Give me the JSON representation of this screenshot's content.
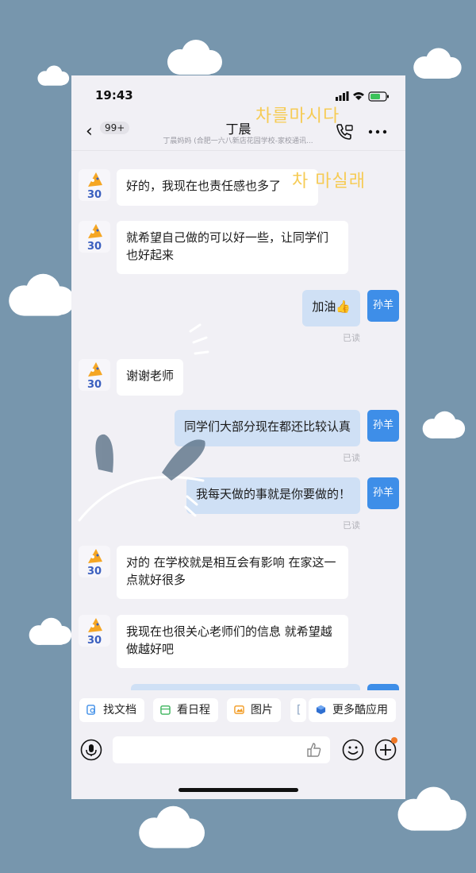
{
  "status_bar": {
    "time": "19:43"
  },
  "header": {
    "back_badge": "99+",
    "title": "丁晨",
    "subtitle": "丁晨妈妈 (合肥一六八新店花园学校-家校通讯..."
  },
  "messages": [
    {
      "side": "left",
      "text": "好的，我现在也责任感也多了"
    },
    {
      "side": "left",
      "text": "就希望自己做的可以好一些，让同学们也好起来"
    },
    {
      "side": "right",
      "text": "加油👍",
      "avatar": "孙羊",
      "status": "已读"
    },
    {
      "side": "left",
      "text": "谢谢老师"
    },
    {
      "side": "right",
      "text": "同学们大部分现在都还比较认真",
      "avatar": "孙羊",
      "status": "已读"
    },
    {
      "side": "right",
      "text": "我每天做的事就是你要做的！",
      "avatar": "孙羊",
      "status": "已读"
    },
    {
      "side": "left",
      "text": "对的 在学校就是相互会有影响 在家这一点就好很多"
    },
    {
      "side": "left",
      "text": "我现在也很关心老师们的信息 就希望越做越好吧"
    },
    {
      "side": "right",
      "text": "",
      "avatar": "",
      "status": ""
    }
  ],
  "quick_actions": [
    "找文档",
    "看日程",
    "图片",
    "更多酷应用"
  ],
  "decor": {
    "sticker_top": "차를마시다",
    "sticker_mid": "차 마실래"
  },
  "colors": {
    "background": "#7796ad",
    "accent": "#3e8ee8",
    "bubble_self": "#cfe0f5"
  }
}
